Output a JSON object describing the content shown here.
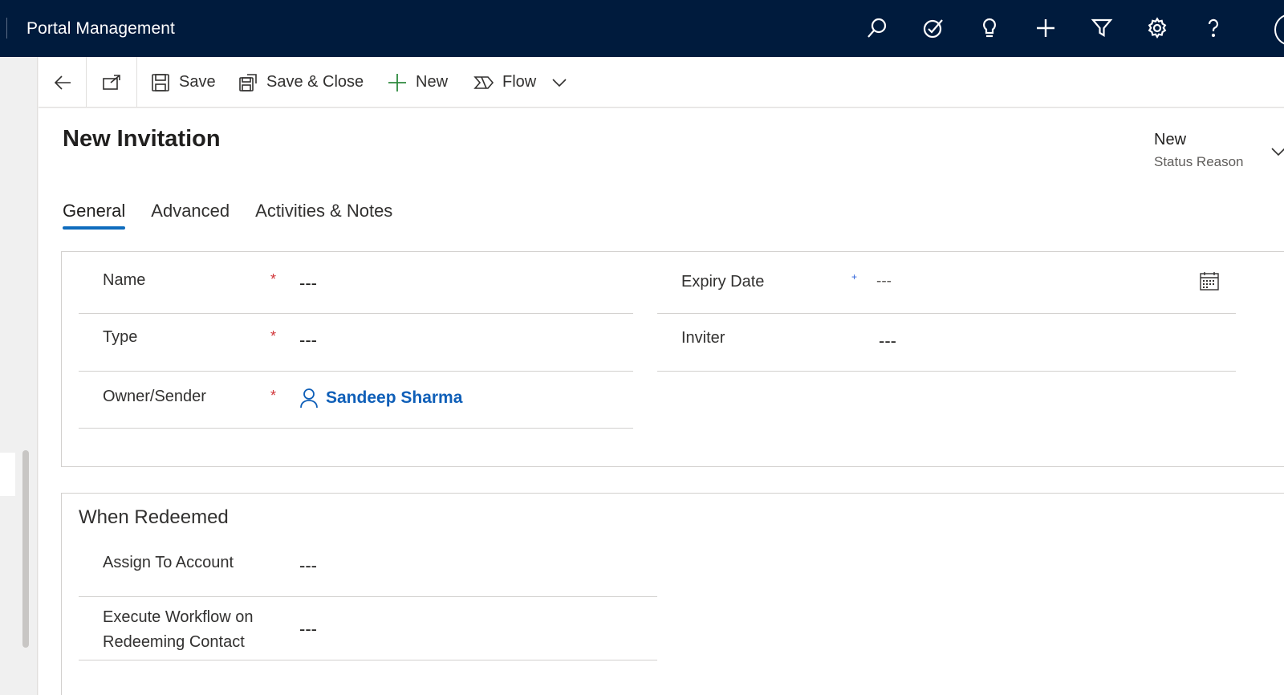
{
  "app": {
    "title": "Portal Management"
  },
  "topbar_icons": [
    "search-icon",
    "task-check-icon",
    "lightbulb-icon",
    "plus-icon",
    "filter-icon",
    "settings-icon",
    "help-icon"
  ],
  "commandbar": {
    "save_label": "Save",
    "save_close_label": "Save & Close",
    "new_label": "New",
    "flow_label": "Flow"
  },
  "record": {
    "title": "New Invitation",
    "status_value": "New",
    "status_label": "Status Reason"
  },
  "tabs": [
    {
      "label": "General",
      "active": true
    },
    {
      "label": "Advanced",
      "active": false
    },
    {
      "label": "Activities & Notes",
      "active": false
    }
  ],
  "general": {
    "left_fields": [
      {
        "label": "Name",
        "required": "*",
        "value": "---"
      },
      {
        "label": "Type",
        "required": "*",
        "value": "---"
      },
      {
        "label": "Owner/Sender",
        "required": "*",
        "value": "Sandeep Sharma"
      }
    ],
    "right_fields": [
      {
        "label": "Expiry Date",
        "required": "+",
        "value": "---"
      },
      {
        "label": "Inviter",
        "value": "---"
      }
    ]
  },
  "redeemed": {
    "title": "When Redeemed",
    "fields": [
      {
        "label": "Assign To Account",
        "value": "---"
      },
      {
        "label_line1": "Execute Workflow on",
        "label_line2": "Redeeming Contact",
        "value": "---"
      }
    ]
  },
  "colors": {
    "topbar_bg": "#001b3d",
    "accent": "#0f6cbd",
    "lookup_link": "#0f5fb8",
    "required": "#d13438",
    "recommended": "#2b5fd9"
  }
}
